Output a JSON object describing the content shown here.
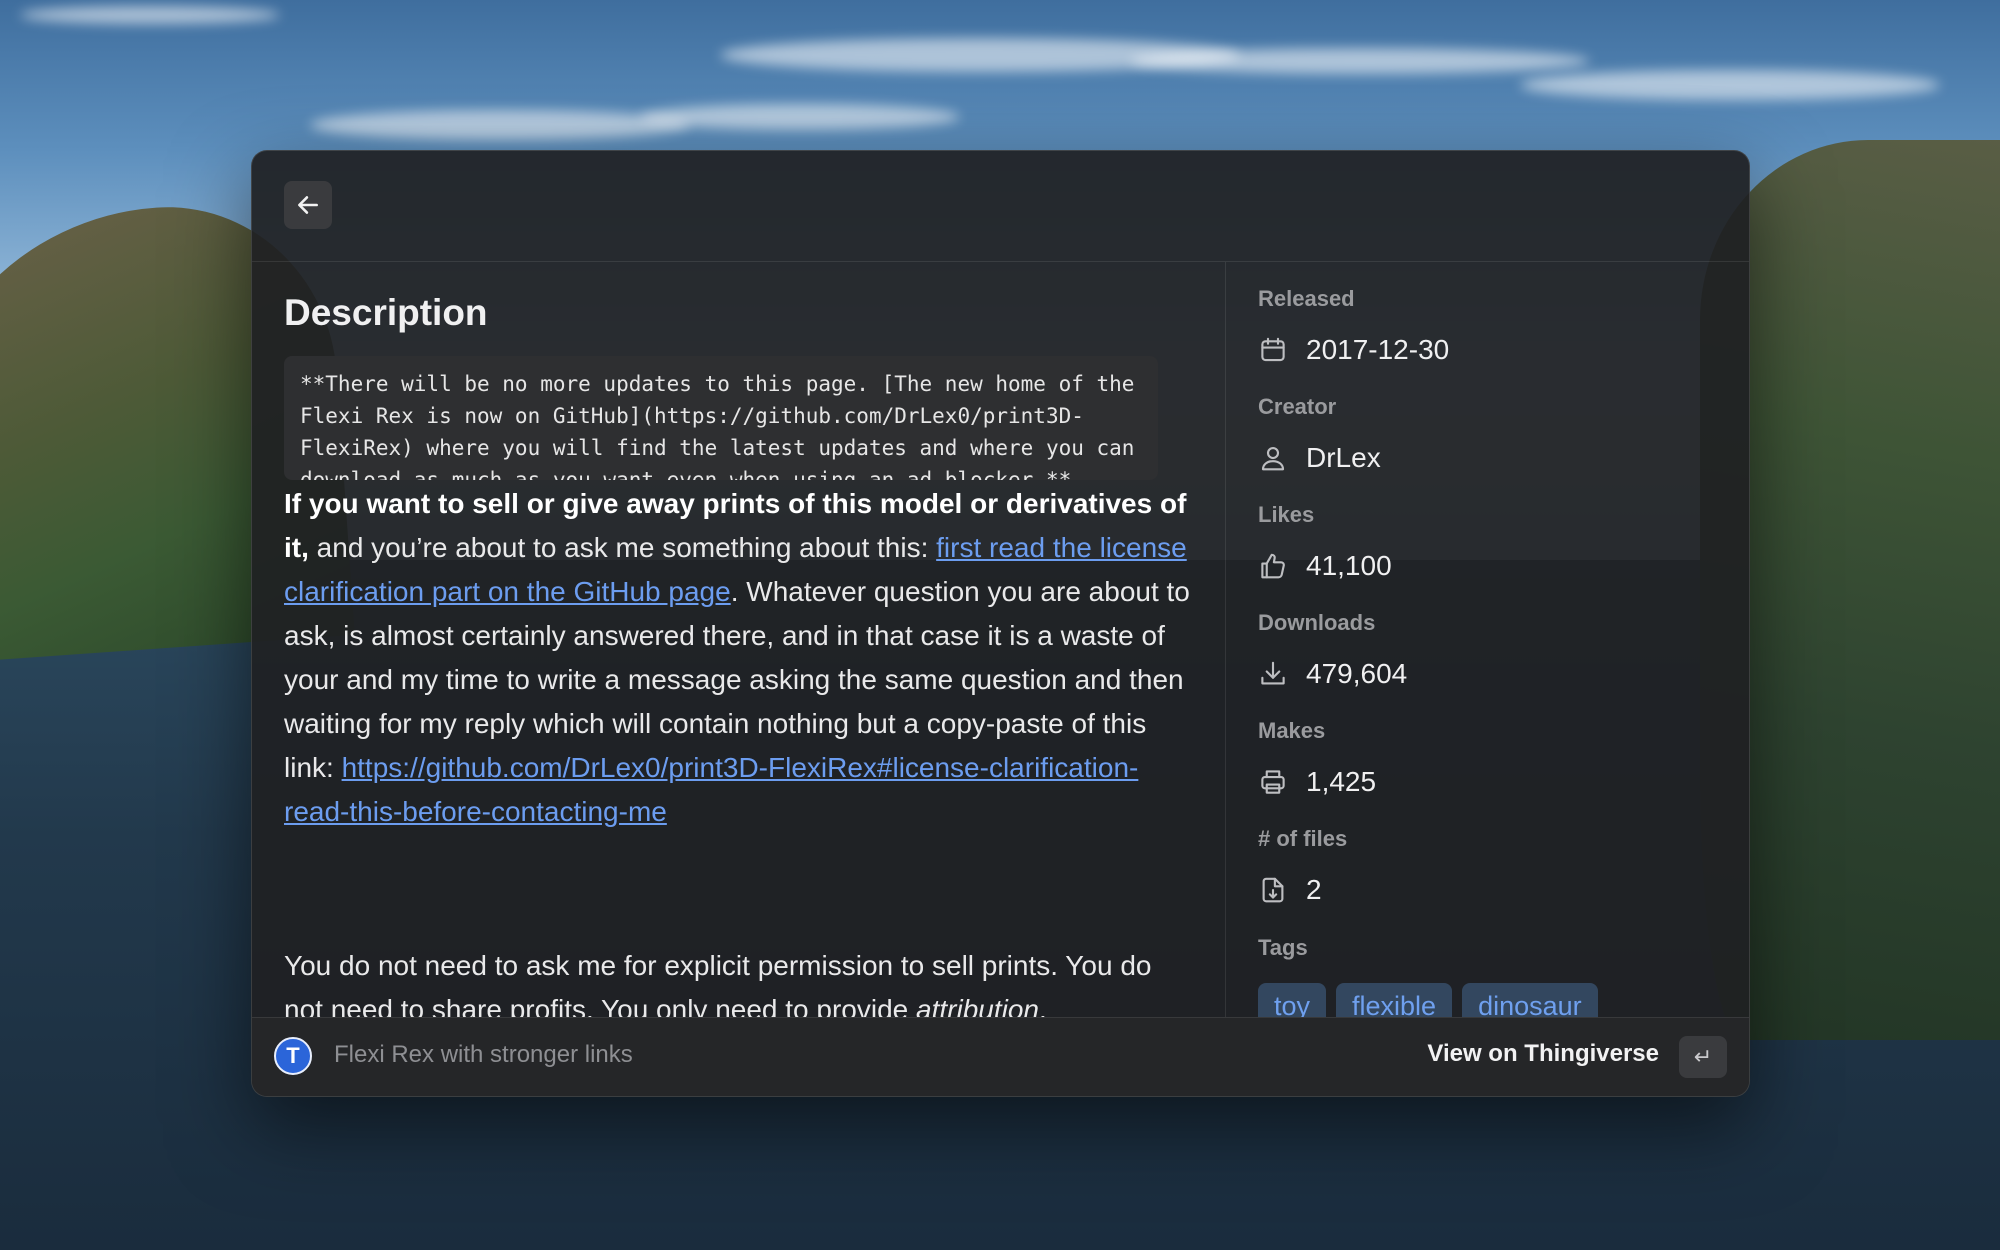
{
  "back_button": {
    "icon": "arrow-left-icon"
  },
  "description": {
    "title": "Description",
    "code": "**There will be no more updates to this page. [The new home of the\nFlexi Rex is now on GitHub](https://github.com/DrLex0/print3D-\nFlexiRex) where you will find the latest updates and where you can\ndownload as much as you want even when using an ad blocker.**",
    "para1_bold": "If you want to sell or give away prints of this model or derivatives of it,",
    "para1_text1": " and you’re about to ask me something about this: ",
    "para1_link1": "first read the license clarification part on the GitHub page",
    "para1_text2": ". Whatever question you are about to ask, is almost certainly answered there, and in that case it is a waste of your and my time to write a message asking the same question and then waiting for my reply which will contain nothing but a copy-paste of this link: ",
    "para1_link2": "https://github.com/DrLex0/print3D-FlexiRex#license-clarification-read-this-before-contacting-me",
    "para2_text": "You do not need to ask me for explicit permission to sell prints. You do not need to share profits. You only need to provide ",
    "para2_em": "attribution",
    "para2_end": "."
  },
  "metadata": {
    "released": {
      "label": "Released",
      "value": "2017-12-30",
      "icon": "calendar-icon"
    },
    "creator": {
      "label": "Creator",
      "value": "DrLex",
      "icon": "person-icon"
    },
    "likes": {
      "label": "Likes",
      "value": "41,100",
      "icon": "thumbs-up-icon"
    },
    "downloads": {
      "label": "Downloads",
      "value": "479,604",
      "icon": "download-icon"
    },
    "makes": {
      "label": "Makes",
      "value": "1,425",
      "icon": "printer-icon"
    },
    "files": {
      "label": "# of files",
      "value": "2",
      "icon": "file-icon"
    },
    "tags": {
      "label": "Tags",
      "items": [
        "toy",
        "flexible",
        "dinosaur"
      ]
    }
  },
  "footer": {
    "logo_letter": "T",
    "title": "Flexi Rex with stronger links",
    "action": "View on Thingiverse",
    "enter_key": "↵"
  },
  "colors": {
    "link": "#6c9df0",
    "tag_bg": "#33475f",
    "logo_bg": "#2b65d9"
  }
}
